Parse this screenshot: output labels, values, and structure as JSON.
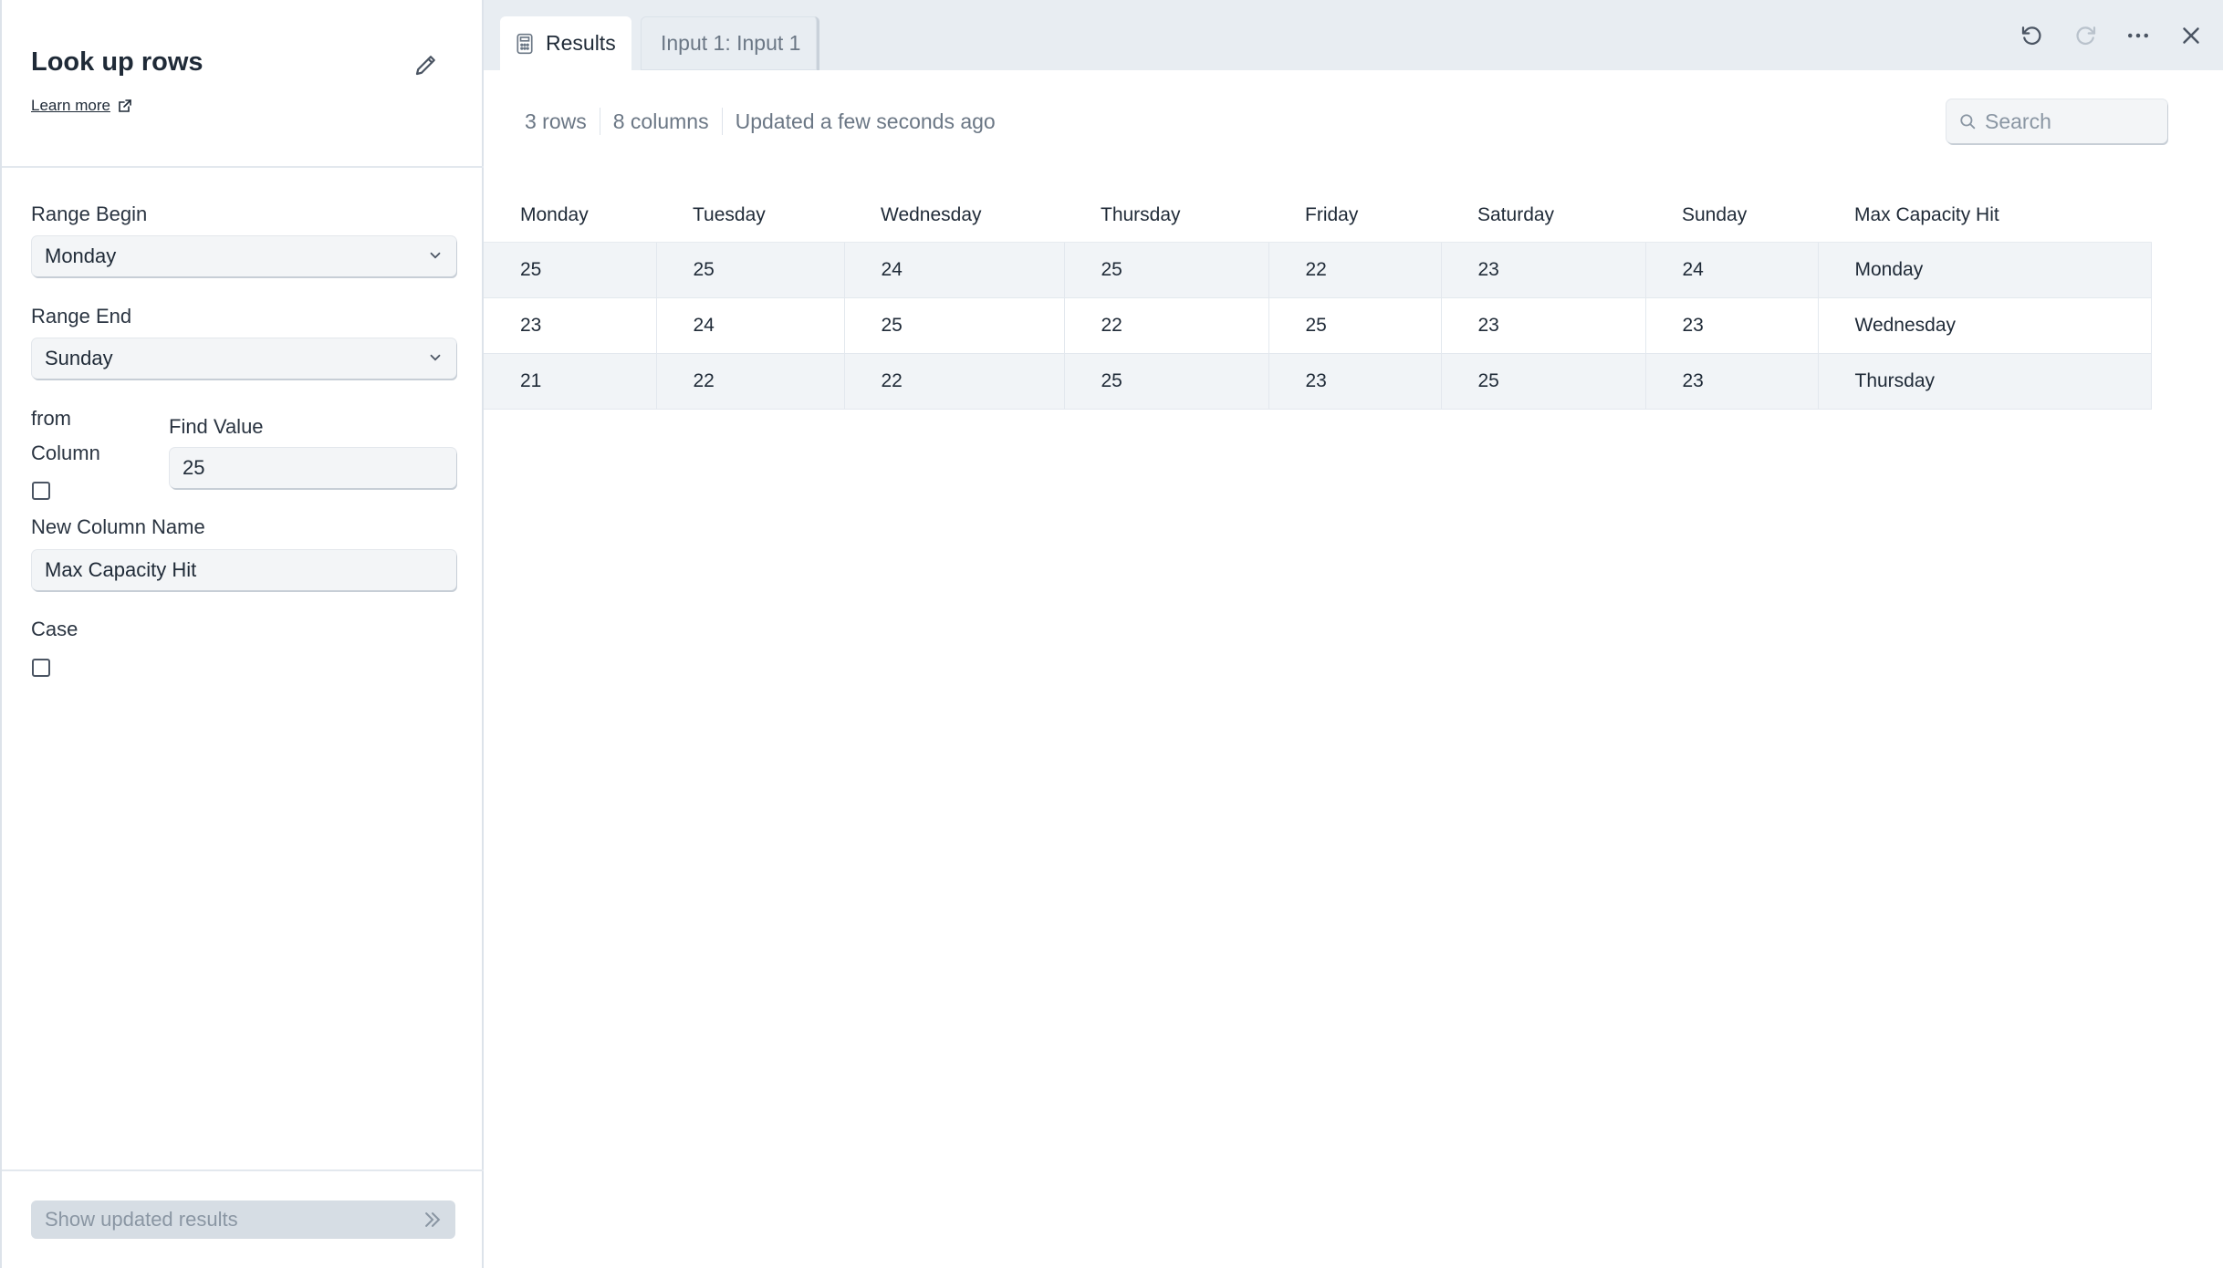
{
  "left": {
    "title": "Look up rows",
    "learn_more": "Learn more",
    "range_begin_label": "Range Begin",
    "range_begin_value": "Monday",
    "range_end_label": "Range End",
    "range_end_value": "Sunday",
    "from_label": "from",
    "column_label": "Column",
    "find_value_label": "Find Value",
    "find_value": "25",
    "new_column_label": "New Column Name",
    "new_column_value": "Max Capacity Hit",
    "case_label": "Case",
    "show_results": "Show updated results"
  },
  "tabs": {
    "results": "Results",
    "input": "Input 1: Input 1"
  },
  "meta": {
    "rows": "3 rows",
    "columns": "8 columns",
    "updated": "Updated a few seconds ago"
  },
  "search": {
    "placeholder": "Search"
  },
  "table": {
    "headers": [
      "Monday",
      "Tuesday",
      "Wednesday",
      "Thursday",
      "Friday",
      "Saturday",
      "Sunday",
      "Max Capacity Hit"
    ],
    "rows": [
      [
        "25",
        "25",
        "24",
        "25",
        "22",
        "23",
        "24",
        "Monday"
      ],
      [
        "23",
        "24",
        "25",
        "22",
        "25",
        "23",
        "23",
        "Wednesday"
      ],
      [
        "21",
        "22",
        "22",
        "25",
        "23",
        "25",
        "23",
        "Thursday"
      ]
    ]
  }
}
